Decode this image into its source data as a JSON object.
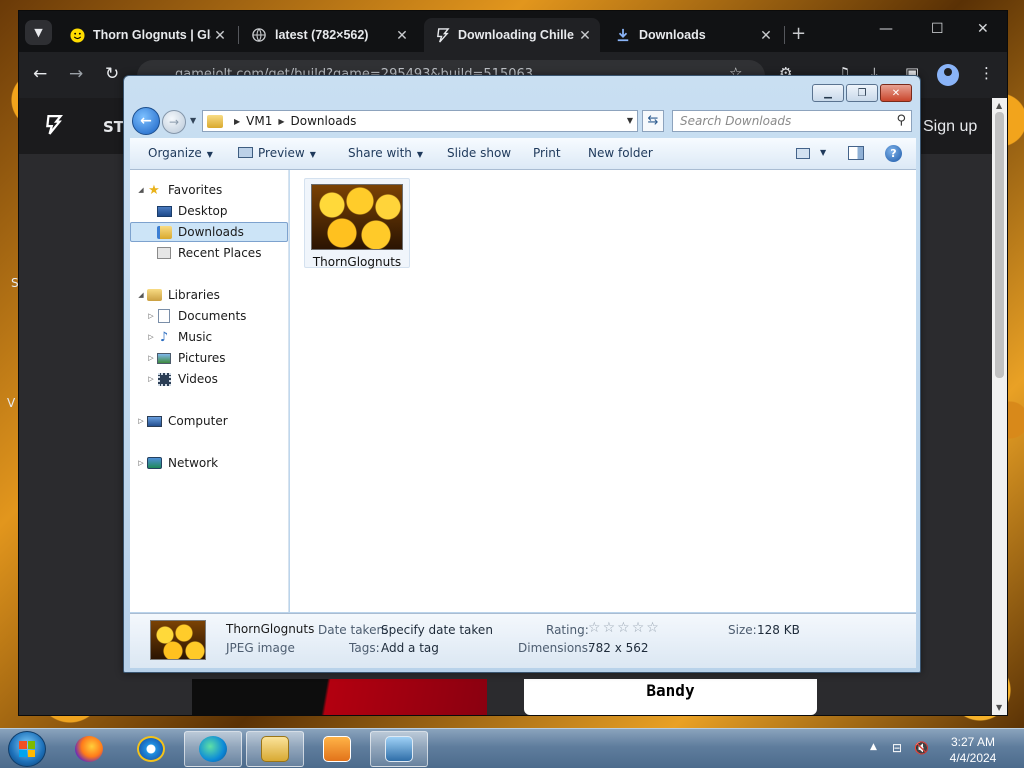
{
  "browser": {
    "tabs": [
      {
        "title": "Thorn Glognuts | Gla",
        "icon": "smiley-icon",
        "active": false
      },
      {
        "title": "latest (782×562)",
        "icon": "globe-icon",
        "active": false
      },
      {
        "title": "Downloading Chille",
        "icon": "gamejolt-icon",
        "active": true
      },
      {
        "title": "Downloads",
        "icon": "download-icon",
        "active": false
      }
    ],
    "url": "gamejolt.com/get/build?game=295493&build=515063",
    "site": {
      "nav_label": "ST",
      "signup": "Sign up",
      "card_text": "Bandy",
      "left_letters": [
        "S",
        "V"
      ]
    }
  },
  "explorer": {
    "breadcrumb": [
      "VM1",
      "Downloads"
    ],
    "search_placeholder": "Search Downloads",
    "commands": {
      "organize": "Organize",
      "preview": "Preview",
      "share_with": "Share with",
      "slide_show": "Slide show",
      "print": "Print",
      "new_folder": "New folder"
    },
    "nav_tree": [
      {
        "label": "Favorites",
        "icon": "star-icon",
        "level": 0,
        "expanded": true
      },
      {
        "label": "Desktop",
        "icon": "desktop-icon",
        "level": 1
      },
      {
        "label": "Downloads",
        "icon": "downloads-folder-icon",
        "level": 1,
        "selected": true
      },
      {
        "label": "Recent Places",
        "icon": "recent-places-icon",
        "level": 1
      },
      {
        "label": "Libraries",
        "icon": "libraries-icon",
        "level": 0,
        "expanded": true
      },
      {
        "label": "Documents",
        "icon": "documents-icon",
        "level": 1
      },
      {
        "label": "Music",
        "icon": "music-icon",
        "level": 1
      },
      {
        "label": "Pictures",
        "icon": "pictures-icon",
        "level": 1
      },
      {
        "label": "Videos",
        "icon": "videos-icon",
        "level": 1
      },
      {
        "label": "Computer",
        "icon": "computer-icon",
        "level": 0
      },
      {
        "label": "Network",
        "icon": "network-icon",
        "level": 0
      }
    ],
    "files": [
      {
        "name": "ThornGlognuts"
      }
    ],
    "details": {
      "name": "ThornGlognuts",
      "type": "JPEG image",
      "date_taken_label": "Date taken:",
      "date_taken_value": "Specify date taken",
      "tags_label": "Tags:",
      "tags_value": "Add a tag",
      "rating_label": "Rating:",
      "dimensions_label": "Dimensions:",
      "dimensions_value": "782 x 562",
      "size_label": "Size:",
      "size_value": "128 KB"
    }
  },
  "taskbar": {
    "time": "3:27 AM",
    "date": "4/4/2024"
  }
}
